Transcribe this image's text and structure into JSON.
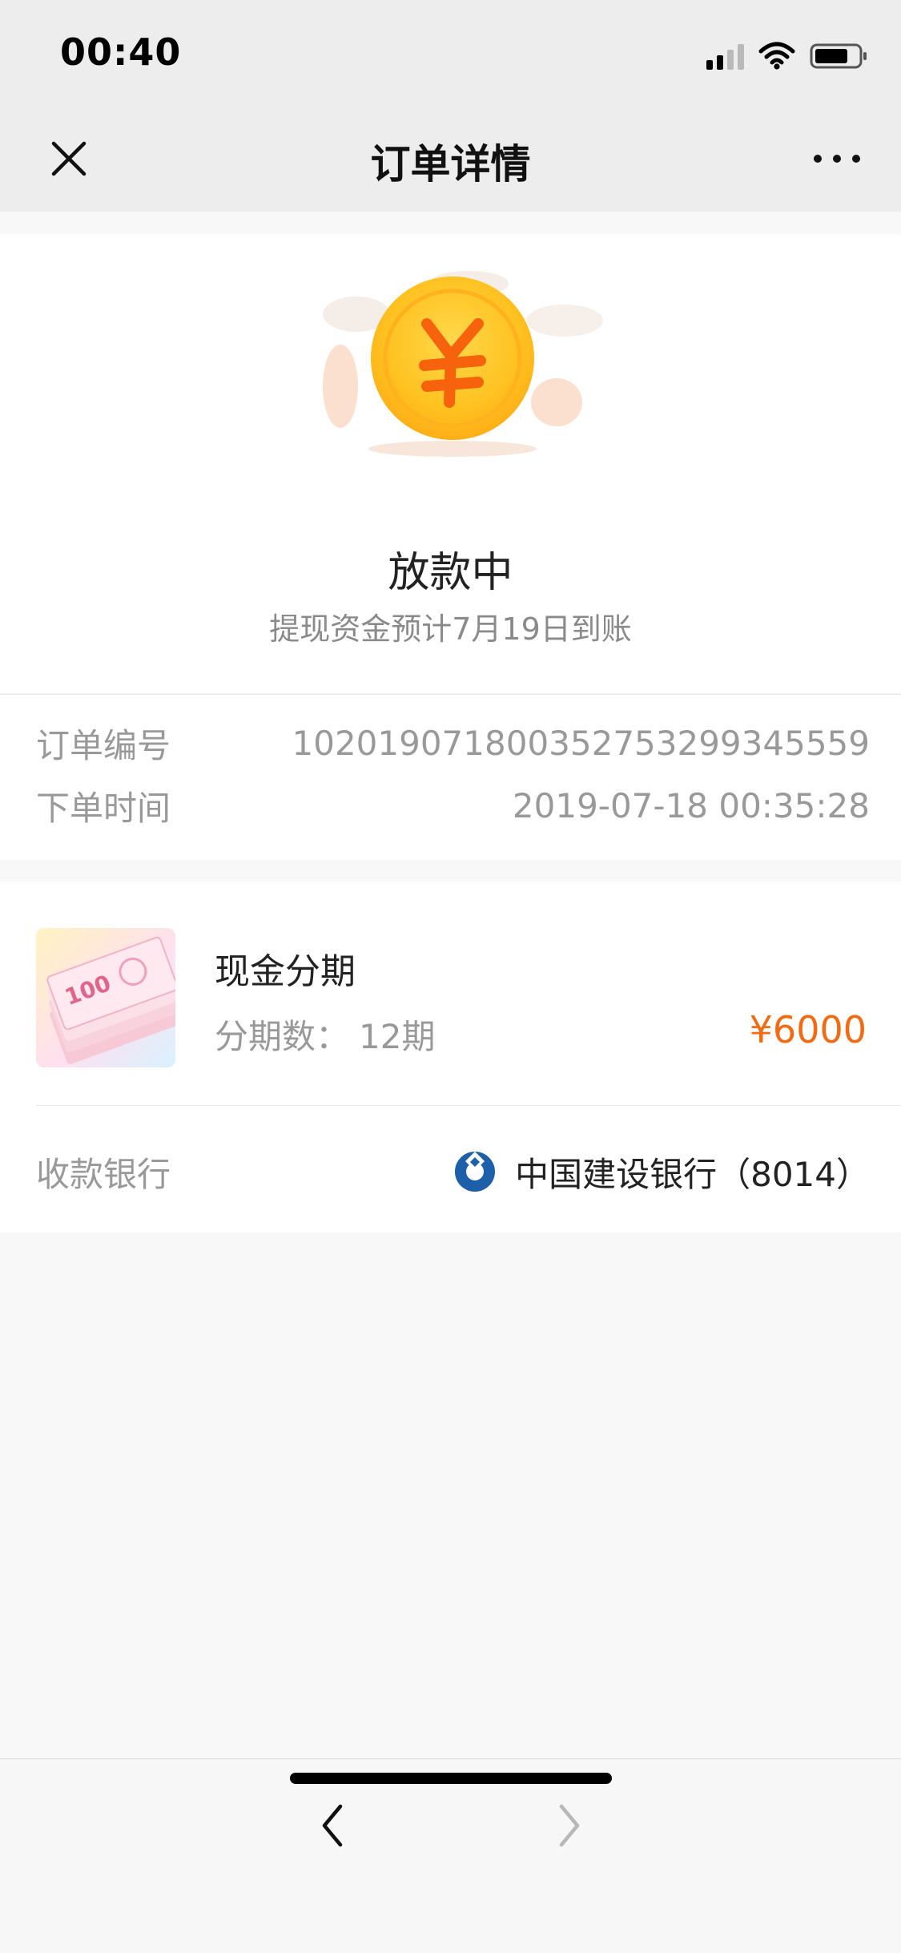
{
  "status_bar": {
    "time": "00:40",
    "signal_icon": "cellular-signal-icon",
    "wifi_icon": "wifi-icon",
    "battery_icon": "battery-icon"
  },
  "nav": {
    "title": "订单详情",
    "close_icon": "close-icon",
    "more_icon": "more-options-icon"
  },
  "hero": {
    "status": "放款中",
    "note": "提现资金预计7月19日到账",
    "illustration_icon": "gold-yuan-coin-icon"
  },
  "order": {
    "number_label": "订单编号",
    "number_value": "102019071800352753299345559",
    "time_label": "下单时间",
    "time_value": "2019-07-18 00:35:28"
  },
  "product": {
    "thumbnail_icon": "banknotes-icon",
    "name": "现金分期",
    "term_label": "分期数：",
    "term_value": "12期",
    "price": "¥6000",
    "price_color": "#f26a12"
  },
  "bank": {
    "label": "收款银行",
    "value": "中国建设银行（8014）",
    "logo_icon": "ccb-bank-logo-icon"
  },
  "bottom_nav": {
    "back_icon": "chevron-left-icon",
    "forward_icon": "chevron-right-icon"
  }
}
